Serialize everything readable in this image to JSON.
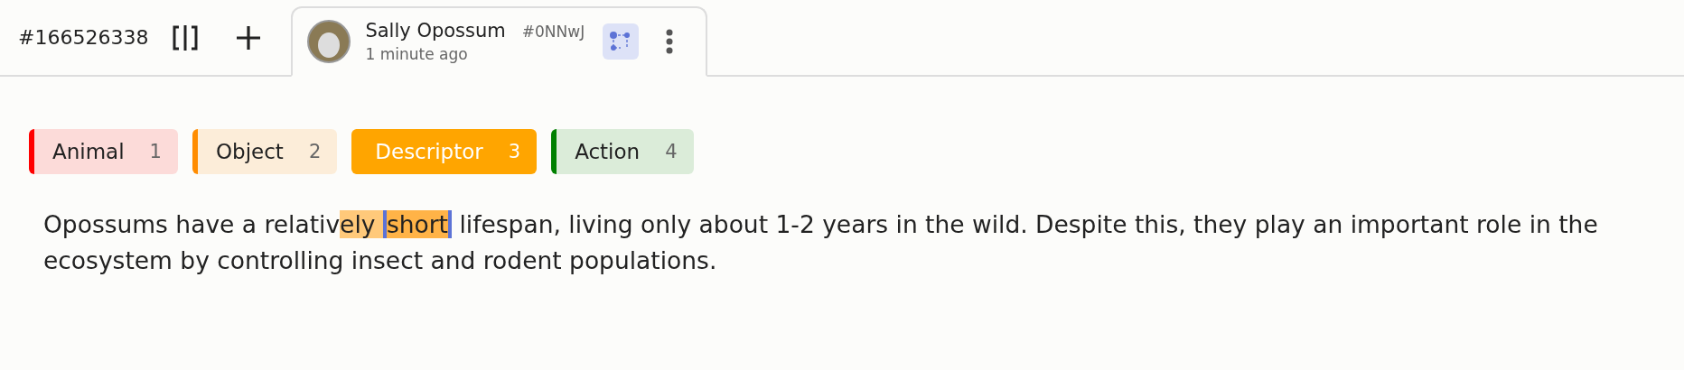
{
  "toolbar": {
    "id": "#166526338"
  },
  "tab": {
    "name": "Sally Opossum",
    "code": "#0NNwJ",
    "time": "1 minute ago",
    "selected": true
  },
  "labels": [
    {
      "name": "Animal",
      "shortcut": "1",
      "color": "#ff0000",
      "selected": false
    },
    {
      "name": "Object",
      "shortcut": "2",
      "color": "#ff8c00",
      "selected": false
    },
    {
      "name": "Descriptor",
      "shortcut": "3",
      "color": "#ffa500",
      "selected": true
    },
    {
      "name": "Action",
      "shortcut": "4",
      "color": "#008000",
      "selected": false
    }
  ],
  "text": [
    {
      "text": "Opossums have a relativ",
      "kind": "plain"
    },
    {
      "text": "ely ",
      "kind": "highlight"
    },
    {
      "text": "short",
      "kind": "selected"
    },
    {
      "text": " lifespan, living only about 1-2 years in the wild. Despite this, they play an important role in the ecosystem by controlling insect and rodent populations.",
      "kind": "plain"
    }
  ]
}
